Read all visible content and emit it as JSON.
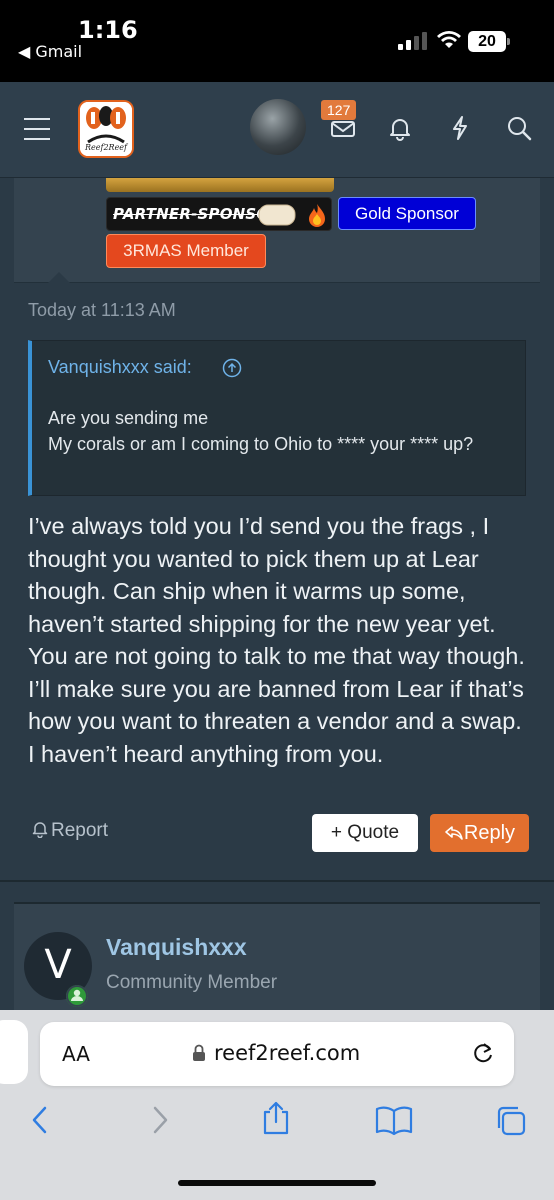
{
  "status_bar": {
    "time": "1:16",
    "back_app": "◀ Gmail",
    "battery": "20"
  },
  "header": {
    "logo_text": "Reef2Reef",
    "inbox_count": "127",
    "icons": [
      "menu-icon",
      "inbox-icon",
      "bell-icon",
      "bolt-icon",
      "search-icon"
    ]
  },
  "post": {
    "banners": {
      "partner": "PARTNER-SPONSOR",
      "gold": "Gold Sponsor",
      "member": "3RMAS Member"
    },
    "timestamp": "Today at 11:13 AM",
    "quote": {
      "author_line": "Vanquishxxx said:",
      "lines": [
        "Are you sending me",
        "My corals or am I coming to Ohio to **** your **** up?"
      ]
    },
    "body": "I’ve always told you I’d send you the frags , I thought you wanted to pick them up at Lear though. Can ship when it warms up some, haven’t started shipping for the new year yet. You are not going to talk to me that way though. I’ll make sure you are banned from Lear if that’s how you want to threaten a vendor and a swap. I haven’t heard anything from you.",
    "actions": {
      "report": "Report",
      "quote": "+ Quote",
      "reply": "Reply"
    }
  },
  "next_post": {
    "avatar_letter": "V",
    "username": "Vanquishxxx",
    "user_title": "Community Member"
  },
  "safari": {
    "aa_label": "AA",
    "url": "reef2reef.com"
  },
  "colors": {
    "page_bg": "#2b3a46",
    "post_bg": "#34434f",
    "accent_orange": "#e26f2e",
    "quote_blue": "#3a93d6",
    "gold_sponsor": "#0000d6",
    "member_badge": "#e4481e"
  }
}
